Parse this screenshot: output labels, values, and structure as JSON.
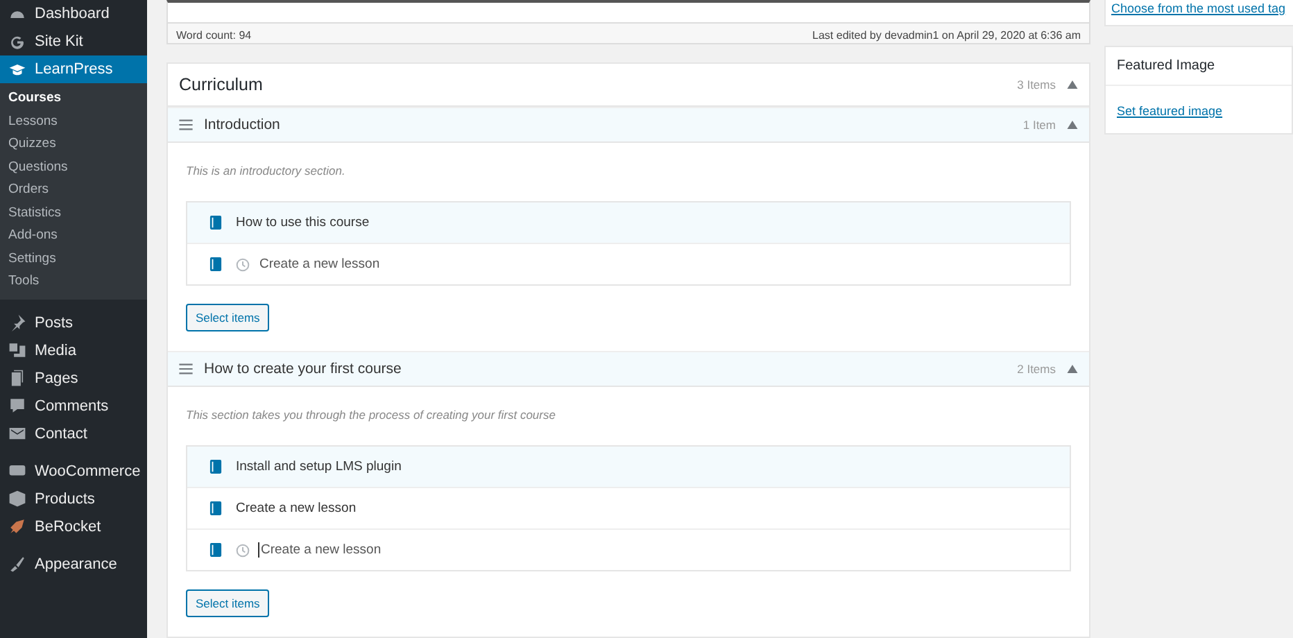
{
  "sidebar": {
    "groups": [
      {
        "items": [
          {
            "label": "Dashboard",
            "selected": false
          },
          {
            "label": "Site Kit",
            "selected": false
          },
          {
            "label": "LearnPress",
            "selected": true,
            "children": [
              {
                "label": "Courses",
                "selected": true
              },
              {
                "label": "Lessons",
                "selected": false
              },
              {
                "label": "Quizzes",
                "selected": false
              },
              {
                "label": "Questions",
                "selected": false
              },
              {
                "label": "Orders",
                "selected": false
              },
              {
                "label": "Statistics",
                "selected": false
              },
              {
                "label": "Add-ons",
                "selected": false
              },
              {
                "label": "Settings",
                "selected": false
              },
              {
                "label": "Tools",
                "selected": false
              }
            ]
          }
        ]
      },
      {
        "items": [
          {
            "label": "Posts",
            "selected": false
          },
          {
            "label": "Media",
            "selected": false
          },
          {
            "label": "Pages",
            "selected": false
          },
          {
            "label": "Comments",
            "selected": false
          },
          {
            "label": "Contact",
            "selected": false
          }
        ]
      },
      {
        "items": [
          {
            "label": "WooCommerce",
            "selected": false
          },
          {
            "label": "Products",
            "selected": false
          },
          {
            "label": "BeRocket",
            "selected": false
          }
        ]
      },
      {
        "items": [
          {
            "label": "Appearance",
            "selected": false
          }
        ]
      }
    ]
  },
  "editor": {
    "word_count": "Word count: 94",
    "last_edited": "Last edited by devadmin1 on April 29, 2020 at 6:36 am"
  },
  "curriculum": {
    "title": "Curriculum",
    "count": "3 Items",
    "expanded": true,
    "sections": [
      {
        "title": "Introduction",
        "count": "1 Item",
        "expanded": true,
        "description": "This is an introductory section.",
        "items": [
          {
            "kind": "lesson",
            "title": "How to use this course",
            "selected": true
          },
          {
            "kind": "new",
            "placeholder": "Create a new lesson",
            "focused": false,
            "selected": false
          }
        ],
        "button": "Select items"
      },
      {
        "title": "How to create your first course",
        "count": "2 Items",
        "expanded": true,
        "description": "This section takes you through the process of creating your first course",
        "items": [
          {
            "kind": "lesson",
            "title": "Install and setup LMS plugin",
            "selected": true
          },
          {
            "kind": "lesson",
            "title": "Create a new lesson",
            "selected": false
          },
          {
            "kind": "new",
            "placeholder": "Create a new lesson",
            "focused": true,
            "selected": false
          }
        ],
        "button": "Select items"
      }
    ]
  },
  "side": {
    "tags_link": "Choose from the most used tag",
    "featured_image": {
      "title": "Featured Image",
      "link": "Set featured image"
    }
  }
}
